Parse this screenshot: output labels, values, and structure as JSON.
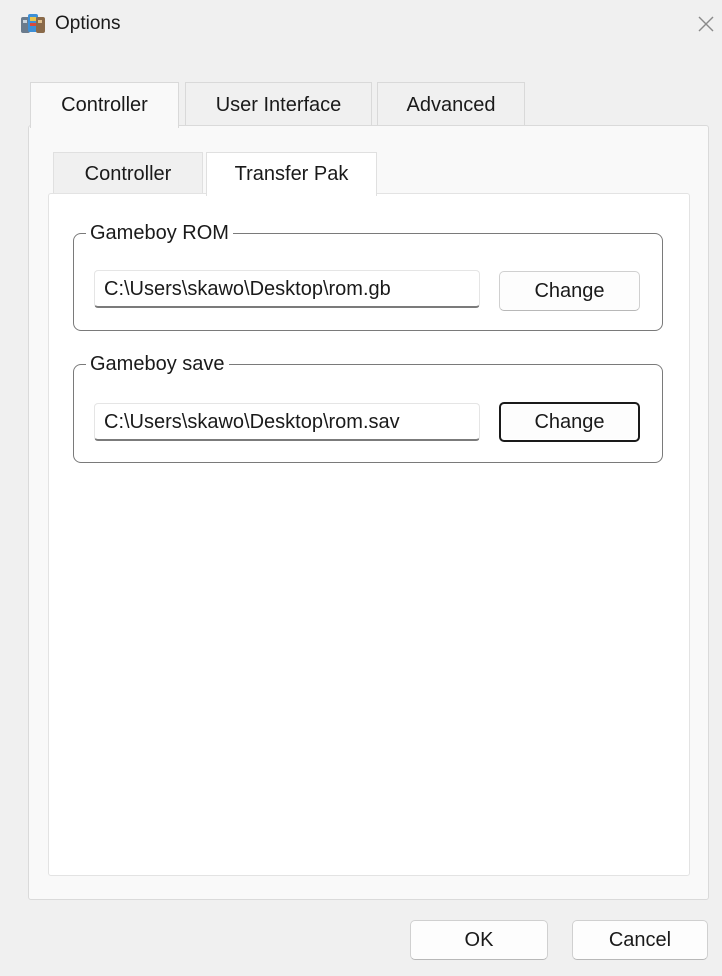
{
  "window": {
    "title": "Options",
    "icon": "app-icon"
  },
  "outer_tabs": [
    {
      "label": "Controller",
      "active": true
    },
    {
      "label": "User Interface",
      "active": false
    },
    {
      "label": "Advanced",
      "active": false
    }
  ],
  "inner_tabs": [
    {
      "label": "Controller",
      "active": false
    },
    {
      "label": "Transfer Pak",
      "active": true
    }
  ],
  "gameboy_rom": {
    "legend": "Gameboy ROM",
    "path": "C:\\Users\\skawo\\Desktop\\rom.gb",
    "button_label": "Change"
  },
  "gameboy_save": {
    "legend": "Gameboy save",
    "path": "C:\\Users\\skawo\\Desktop\\rom.sav",
    "button_label": "Change"
  },
  "footer": {
    "ok_label": "OK",
    "cancel_label": "Cancel"
  }
}
